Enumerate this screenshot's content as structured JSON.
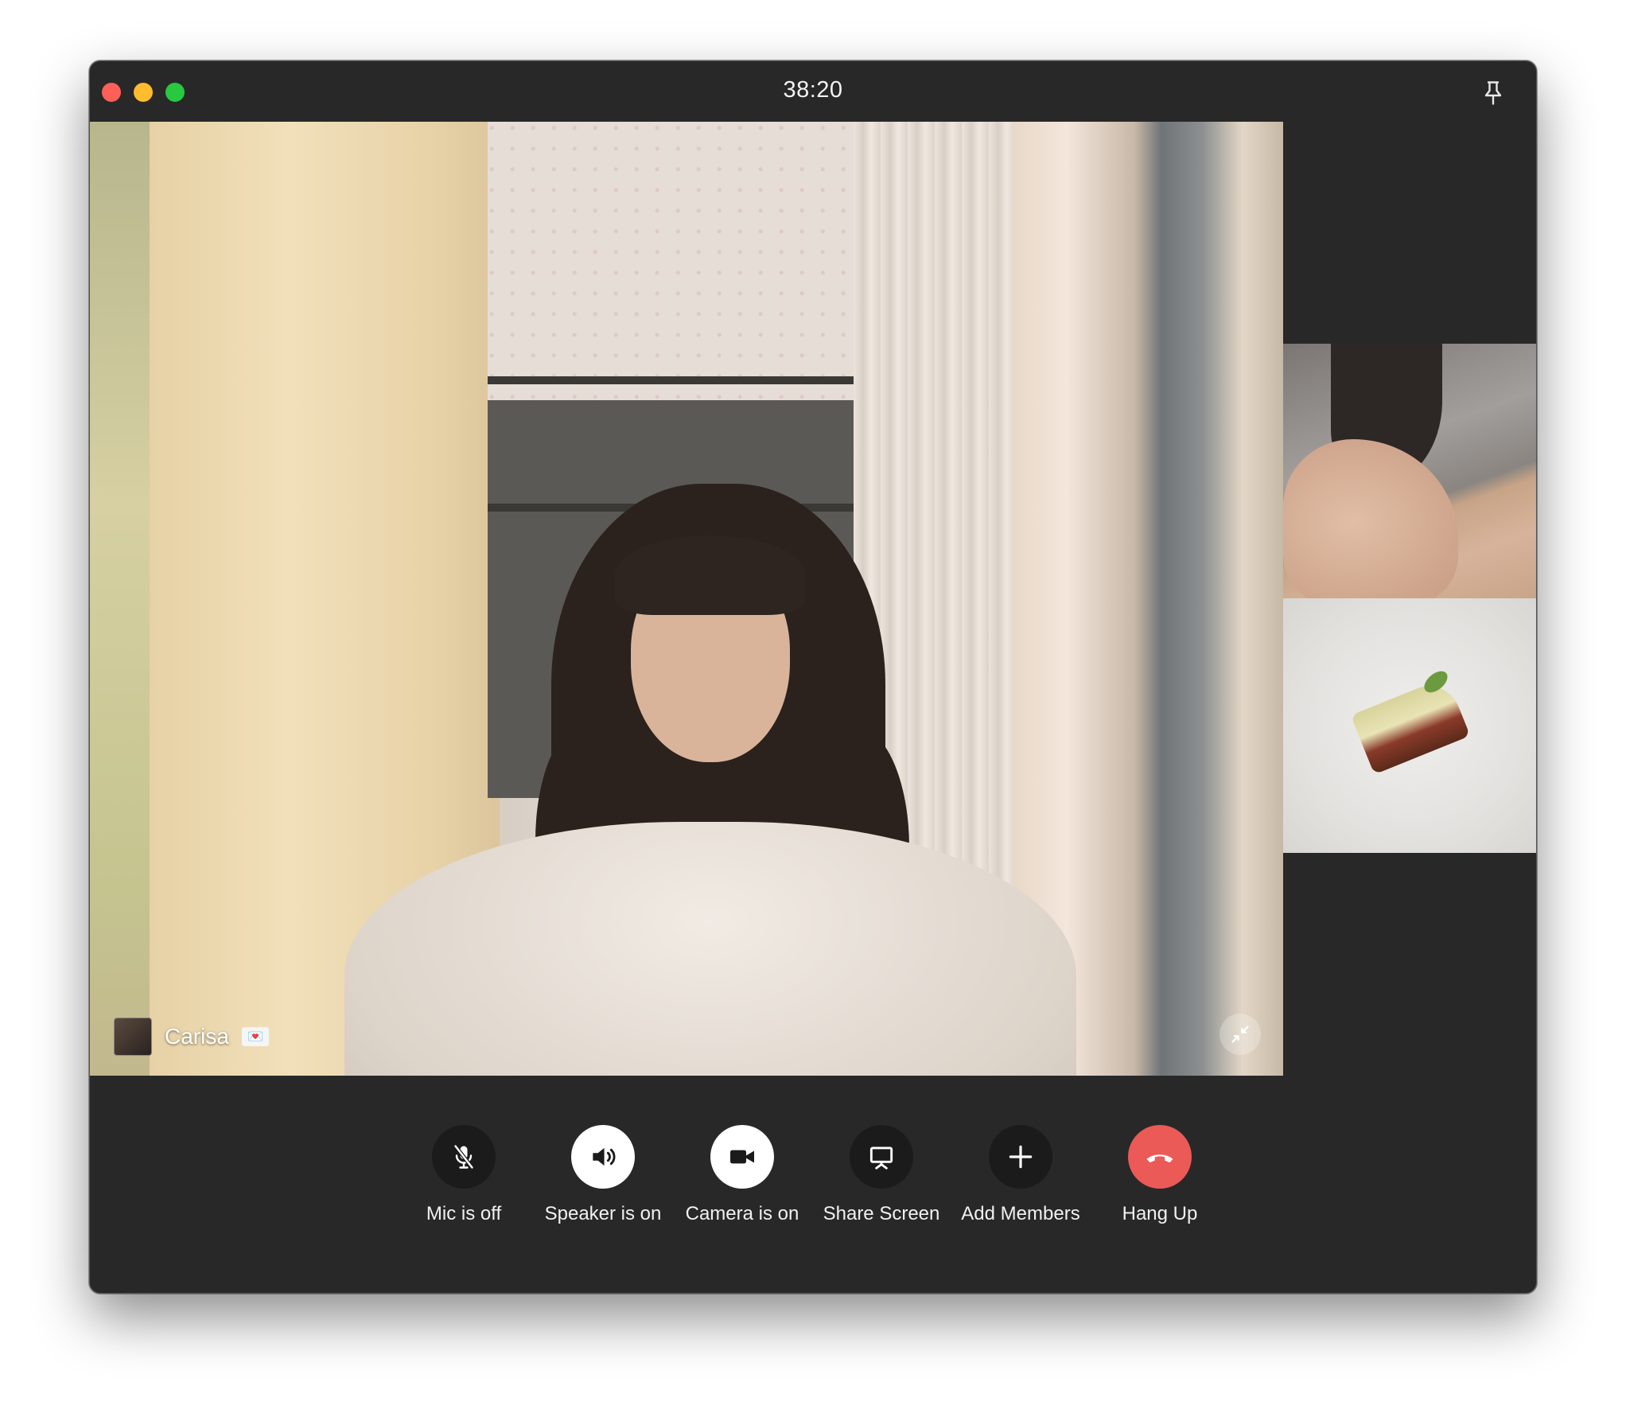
{
  "window": {
    "timer": "38:20"
  },
  "main_video": {
    "participant_name": "Carisa",
    "participant_emoji": "💌"
  },
  "thumbnails": [
    {
      "label": ""
    },
    {
      "label": ""
    }
  ],
  "controls": [
    {
      "label": "Mic is off",
      "icon": "mic-off-icon",
      "state": "off"
    },
    {
      "label": "Speaker is on",
      "icon": "speaker-icon",
      "state": "on"
    },
    {
      "label": "Camera is on",
      "icon": "camera-icon",
      "state": "on"
    },
    {
      "label": "Share Screen",
      "icon": "screen-share-icon",
      "state": "idle"
    },
    {
      "label": "Add Members",
      "icon": "plus-icon",
      "state": "idle"
    },
    {
      "label": "Hang Up",
      "icon": "hang-up-icon",
      "state": "danger"
    }
  ],
  "colors": {
    "window_bg": "#282828",
    "button_dark": "#1b1b1b",
    "button_active": "#ffffff",
    "hang_up": "#eb5a57"
  }
}
